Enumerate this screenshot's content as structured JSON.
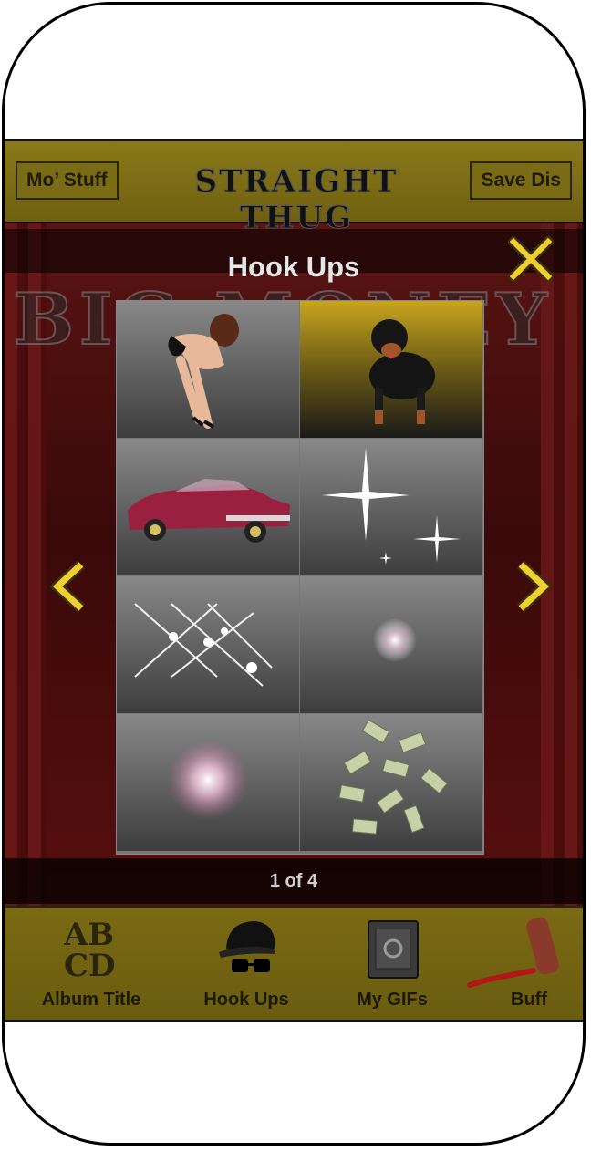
{
  "header": {
    "left_button": "Mo’ Stuff",
    "logo": "STRAIGHT THUG",
    "right_button": "Save Dis"
  },
  "scene": {
    "title_text": "BIG MONEY"
  },
  "overlay": {
    "title": "Hook Ups",
    "page_indicator": "1 of 4"
  },
  "grid_items": [
    "pinup-girl",
    "rottweiler",
    "lowrider-car",
    "sparkles",
    "star-flares",
    "lens-flare",
    "pink-glow",
    "money-bills"
  ],
  "tabs": [
    {
      "label": "Album Title",
      "icon": "abcd-letters-icon"
    },
    {
      "label": "Hook Ups",
      "icon": "cap-sunglasses-icon"
    },
    {
      "label": "My GIFs",
      "icon": "safe-icon"
    },
    {
      "label": "Buff",
      "icon": "paint-roller-icon"
    }
  ],
  "colors": {
    "gold": "#d4b21e",
    "bar": "#7a6a14",
    "overlay_text": "#e6e6e6"
  }
}
